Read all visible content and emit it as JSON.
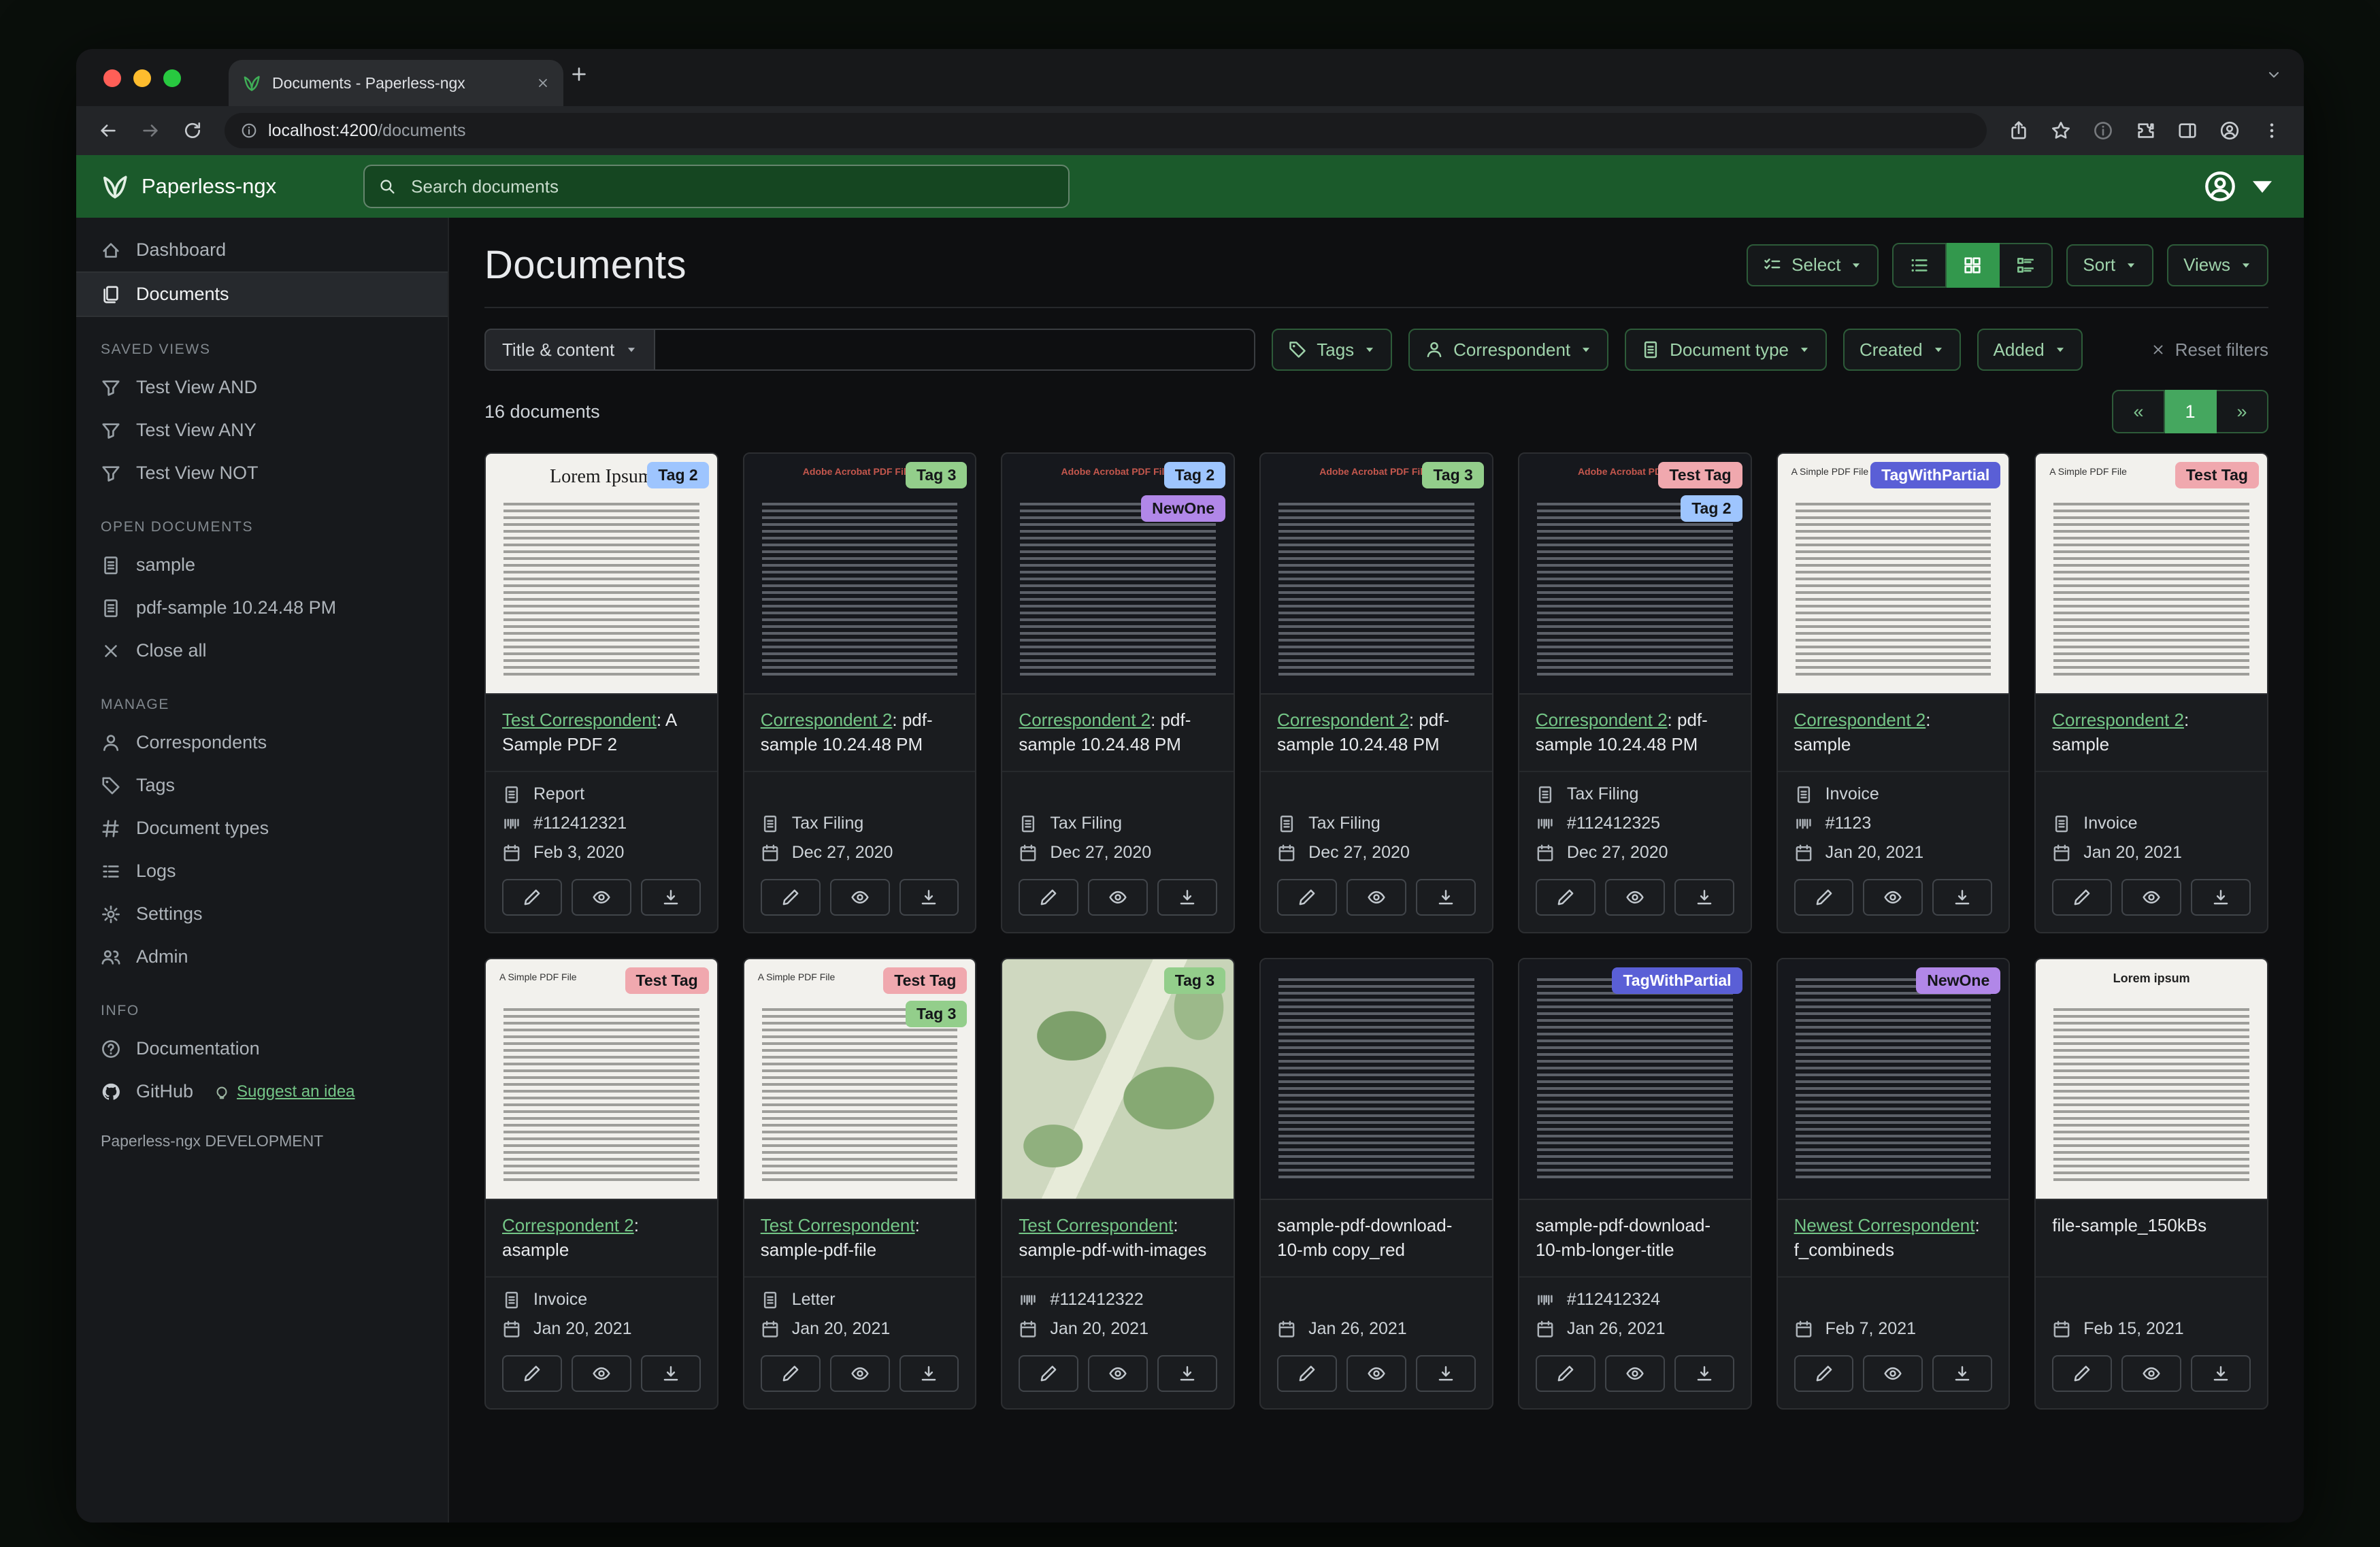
{
  "browser": {
    "tab_title": "Documents - Paperless-ngx",
    "url_host": "localhost:4200",
    "url_path": "/documents"
  },
  "header": {
    "app_name": "Paperless-ngx",
    "search_placeholder": "Search documents"
  },
  "sidebar": {
    "nav": [
      "Dashboard",
      "Documents"
    ],
    "saved_views_header": "SAVED VIEWS",
    "saved_views": [
      "Test View AND",
      "Test View ANY",
      "Test View NOT"
    ],
    "open_documents_header": "OPEN DOCUMENTS",
    "open_documents": [
      "sample",
      "pdf-sample 10.24.48 PM"
    ],
    "close_all": "Close all",
    "manage_header": "MANAGE",
    "manage": [
      "Correspondents",
      "Tags",
      "Document types",
      "Logs",
      "Settings",
      "Admin"
    ],
    "info_header": "INFO",
    "documentation": "Documentation",
    "github": "GitHub",
    "suggest_idea": "Suggest an idea",
    "footer": "Paperless-ngx DEVELOPMENT"
  },
  "toolbar": {
    "page_title": "Documents",
    "select_label": "Select",
    "sort_label": "Sort",
    "views_label": "Views"
  },
  "filters": {
    "title_content_label": "Title & content",
    "tags_label": "Tags",
    "correspondent_label": "Correspondent",
    "document_type_label": "Document type",
    "created_label": "Created",
    "added_label": "Added",
    "reset_label": "Reset filters"
  },
  "results": {
    "count": "16 documents",
    "page": "1",
    "prev": "«",
    "next": "»"
  },
  "tag_colors": {
    "Tag 2": {
      "bg": "#9ec5fe",
      "fg": "#141619"
    },
    "Tag 3": {
      "bg": "#93ce8b",
      "fg": "#141619"
    },
    "Test Tag": {
      "bg": "#f0a8ae",
      "fg": "#141619"
    },
    "NewOne": {
      "bg": "#b187e8",
      "fg": "#141619"
    },
    "TagWithPartial": {
      "bg": "#5a5fd6",
      "fg": "#ffffff"
    }
  },
  "cards": [
    {
      "tags": [
        "Tag 2"
      ],
      "thumb": {
        "kind": "light",
        "heading": "Lorem Ipsum",
        "hstyle": "serif"
      },
      "title_link": "Test Correspondent",
      "title_rest": ": A Sample PDF 2",
      "meta": [
        {
          "icon": "file",
          "text": "Report"
        },
        {
          "icon": "upc",
          "text": "#112412321"
        },
        {
          "icon": "calendar",
          "text": "Feb 3, 2020"
        }
      ]
    },
    {
      "tags": [
        "Tag 3"
      ],
      "thumb": {
        "kind": "dark",
        "heading": "Adobe Acrobat PDF Files",
        "hstyle": "red"
      },
      "title_link": "Correspondent 2",
      "title_rest": ": pdf-sample 10.24.48 PM",
      "meta": [
        {
          "icon": "file",
          "text": "Tax Filing"
        },
        {
          "icon": "calendar",
          "text": "Dec 27, 2020"
        }
      ]
    },
    {
      "tags": [
        "Tag 2",
        "NewOne"
      ],
      "thumb": {
        "kind": "dark",
        "heading": "Adobe Acrobat PDF Files",
        "hstyle": "red"
      },
      "title_link": "Correspondent 2",
      "title_rest": ": pdf-sample 10.24.48 PM",
      "meta": [
        {
          "icon": "file",
          "text": "Tax Filing"
        },
        {
          "icon": "calendar",
          "text": "Dec 27, 2020"
        }
      ]
    },
    {
      "tags": [
        "Tag 3"
      ],
      "thumb": {
        "kind": "dark",
        "heading": "Adobe Acrobat PDF Files",
        "hstyle": "red"
      },
      "title_link": "Correspondent 2",
      "title_rest": ": pdf-sample 10.24.48 PM",
      "meta": [
        {
          "icon": "file",
          "text": "Tax Filing"
        },
        {
          "icon": "calendar",
          "text": "Dec 27, 2020"
        }
      ]
    },
    {
      "tags": [
        "Test Tag",
        "Tag 2"
      ],
      "thumb": {
        "kind": "dark",
        "heading": "Adobe Acrobat PDF Files",
        "hstyle": "red"
      },
      "title_link": "Correspondent 2",
      "title_rest": ": pdf-sample 10.24.48 PM",
      "meta": [
        {
          "icon": "file",
          "text": "Tax Filing"
        },
        {
          "icon": "upc",
          "text": "#112412325"
        },
        {
          "icon": "calendar",
          "text": "Dec 27, 2020"
        }
      ]
    },
    {
      "tags": [
        "TagWithPartial"
      ],
      "thumb": {
        "kind": "light",
        "heading": "A Simple PDF File",
        "hstyle": "small"
      },
      "title_link": "Correspondent 2",
      "title_rest": ": sample",
      "meta": [
        {
          "icon": "file",
          "text": "Invoice"
        },
        {
          "icon": "upc",
          "text": "#1123"
        },
        {
          "icon": "calendar",
          "text": "Jan 20, 2021"
        }
      ]
    },
    {
      "tags": [
        "Test Tag"
      ],
      "thumb": {
        "kind": "light",
        "heading": "A Simple PDF File",
        "hstyle": "small"
      },
      "title_link": "Correspondent 2",
      "title_rest": ": sample",
      "meta": [
        {
          "icon": "file",
          "text": "Invoice"
        },
        {
          "icon": "calendar",
          "text": "Jan 20, 2021"
        }
      ]
    },
    {
      "tags": [
        "Test Tag"
      ],
      "thumb": {
        "kind": "light",
        "heading": "A Simple PDF File",
        "hstyle": "small"
      },
      "title_link": "Correspondent 2",
      "title_rest": ": asample",
      "meta": [
        {
          "icon": "file",
          "text": "Invoice"
        },
        {
          "icon": "calendar",
          "text": "Jan 20, 2021"
        }
      ]
    },
    {
      "tags": [
        "Test Tag",
        "Tag 3"
      ],
      "thumb": {
        "kind": "light",
        "heading": "A Simple PDF File",
        "hstyle": "small"
      },
      "title_link": "Test Correspondent",
      "title_rest": ": sample-pdf-file",
      "meta": [
        {
          "icon": "file",
          "text": "Letter"
        },
        {
          "icon": "calendar",
          "text": "Jan 20, 2021"
        }
      ]
    },
    {
      "tags": [
        "Tag 3"
      ],
      "thumb": {
        "kind": "map",
        "heading": "",
        "hstyle": ""
      },
      "title_link": "Test Correspondent",
      "title_rest": ": sample-pdf-with-images",
      "meta": [
        {
          "icon": "upc",
          "text": "#112412322"
        },
        {
          "icon": "calendar",
          "text": "Jan 20, 2021"
        }
      ]
    },
    {
      "tags": [],
      "thumb": {
        "kind": "dark",
        "heading": "",
        "hstyle": ""
      },
      "title_link": null,
      "title_rest": "sample-pdf-download-10-mb copy_red",
      "meta": [
        {
          "icon": "calendar",
          "text": "Jan 26, 2021"
        }
      ]
    },
    {
      "tags": [
        "TagWithPartial"
      ],
      "thumb": {
        "kind": "dark",
        "heading": "",
        "hstyle": ""
      },
      "title_link": null,
      "title_rest": "sample-pdf-download-10-mb-longer-title",
      "meta": [
        {
          "icon": "upc",
          "text": "#112412324"
        },
        {
          "icon": "calendar",
          "text": "Jan 26, 2021"
        }
      ]
    },
    {
      "tags": [
        "NewOne"
      ],
      "thumb": {
        "kind": "dark",
        "heading": "",
        "hstyle": ""
      },
      "title_link": "Newest Correspondent",
      "title_rest": ": f_combineds",
      "meta": [
        {
          "icon": "calendar",
          "text": "Feb 7, 2021"
        }
      ]
    },
    {
      "tags": [],
      "thumb": {
        "kind": "light",
        "heading": "Lorem ipsum",
        "hstyle": "bold"
      },
      "title_link": null,
      "title_rest": "file-sample_150kBs",
      "meta": [
        {
          "icon": "calendar",
          "text": "Feb 15, 2021"
        }
      ]
    }
  ]
}
